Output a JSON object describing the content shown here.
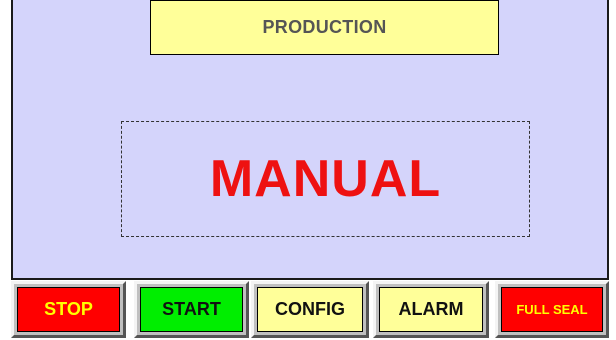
{
  "header": {
    "title": "PRODUCTION"
  },
  "main": {
    "mode_label": "MANUAL"
  },
  "buttons": [
    {
      "id": "stop",
      "label": "STOP",
      "bg": "#ff0000",
      "fg": "#ffff00"
    },
    {
      "id": "start",
      "label": "START",
      "bg": "#00ee00",
      "fg": "#111111"
    },
    {
      "id": "config",
      "label": "CONFIG",
      "bg": "#ffff99",
      "fg": "#111111"
    },
    {
      "id": "alarm",
      "label": "ALARM",
      "bg": "#ffff99",
      "fg": "#111111"
    },
    {
      "id": "full_seal",
      "label": "FULL SEAL",
      "bg": "#ff0000",
      "fg": "#ffff00"
    }
  ],
  "colors": {
    "panel_bg": "#d4d4fb",
    "mode_text": "#ee1111",
    "title_bg": "#ffff99"
  }
}
